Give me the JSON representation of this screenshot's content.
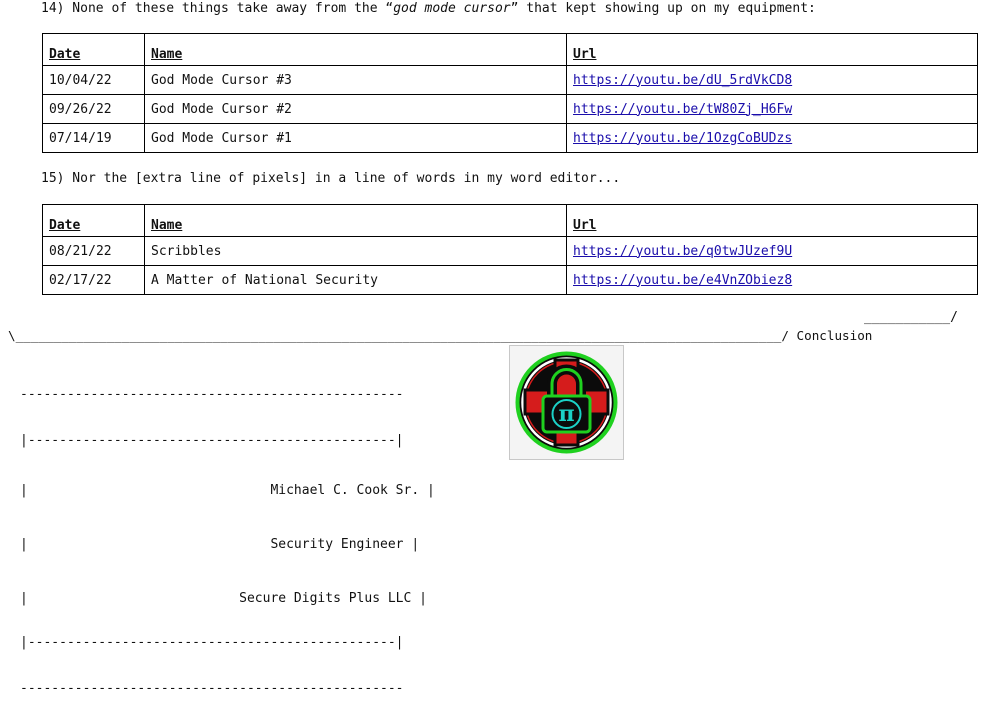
{
  "item14": {
    "prefix": "14) None of these things take away from the “",
    "emph": "god mode cursor",
    "suffix": "” that kept showing up on my equipment:"
  },
  "table1": {
    "headers": [
      "Date",
      "Name",
      "Url"
    ],
    "rows": [
      {
        "date": "10/04/22",
        "name": "God Mode Cursor #3",
        "url": "https://youtu.be/dU_5rdVkCD8"
      },
      {
        "date": "09/26/22",
        "name": "God Mode Cursor #2",
        "url": "https://youtu.be/tW80Zj_H6Fw"
      },
      {
        "date": "07/14/19",
        "name": "God Mode Cursor #1",
        "url": "https://youtu.be/1OzgCoBUDzs"
      }
    ]
  },
  "item15": {
    "text": "15) Nor the [extra line of pixels] in a line of words in my word editor..."
  },
  "table2": {
    "headers": [
      "Date",
      "Name",
      "Url"
    ],
    "rows": [
      {
        "date": "08/21/22",
        "name": "Scribbles",
        "url": "https://youtu.be/q0twJUzef9U"
      },
      {
        "date": "02/17/22",
        "name": "A Matter of National Security",
        "url": "https://youtu.be/e4VnZObiez8"
      }
    ]
  },
  "divider": {
    "top": "___________/",
    "bottom": "\\_____________________________________________________________________________________________________/ Conclusion"
  },
  "signature": {
    "border_top": "-------------------------------------------------",
    "border_top2": "|-----------------------------------------------|",
    "line_empty": "|                                               |",
    "line1": "|                               Michael C. Cook Sr. |",
    "line2": "|                               Security Engineer |",
    "line3": "|                           Secure Digits Plus LLC |",
    "border_bottom2": "|-----------------------------------------------|",
    "border_bottom": "-------------------------------------------------",
    "name": "Michael C. Cook Sr.",
    "title": "Security Engineer",
    "company": "Secure Digits Plus LLC"
  },
  "logo": {
    "icon": "pi-lock-cross-logo",
    "glyph": "π",
    "colors": {
      "ring": "#1fd11f",
      "cross": "#d51c1c",
      "lock": "#1bd1c7",
      "body": "#0b0b0b"
    }
  }
}
